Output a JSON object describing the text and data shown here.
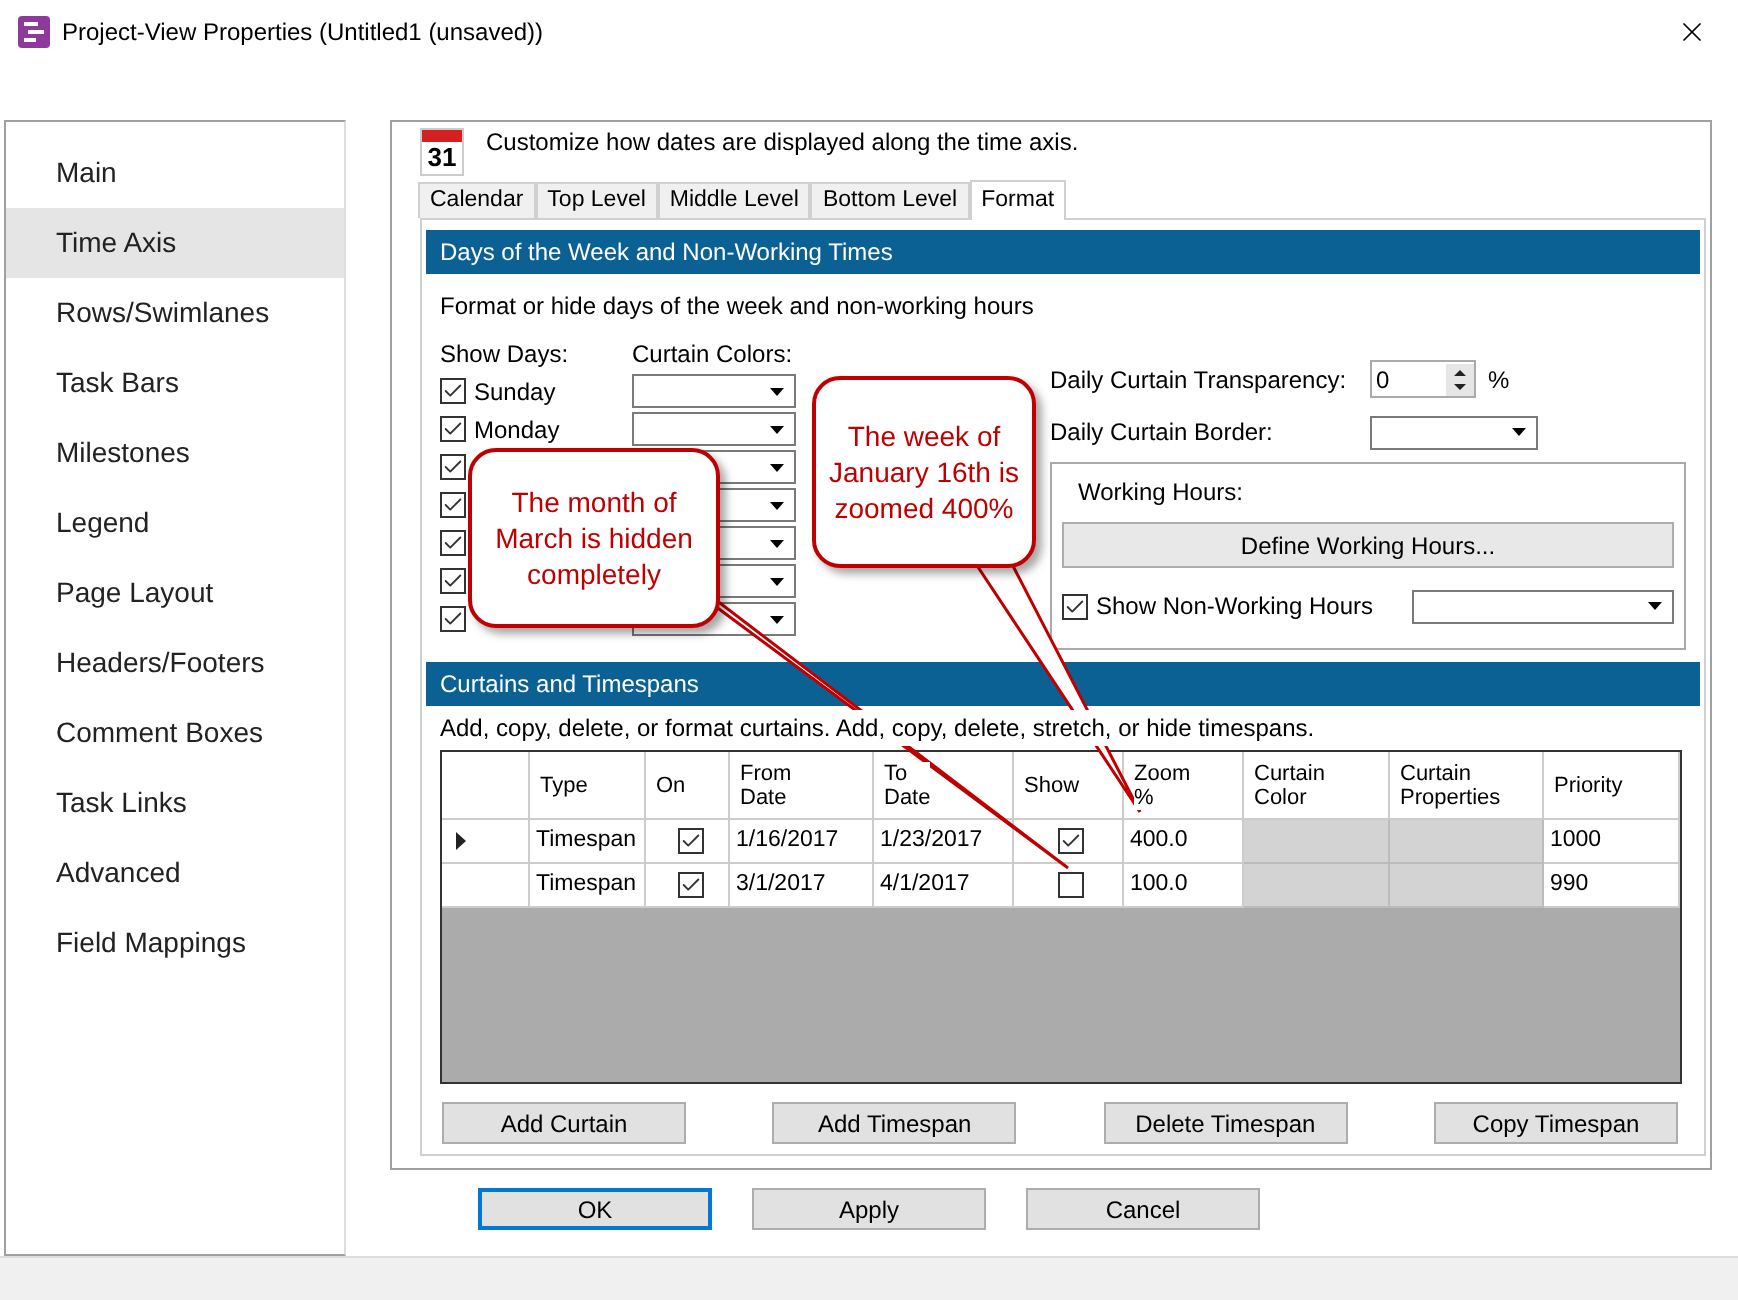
{
  "window": {
    "title": "Project-View Properties (Untitled1 (unsaved))"
  },
  "sidebar": {
    "items": [
      {
        "label": "Main",
        "selected": false
      },
      {
        "label": "Time Axis",
        "selected": true
      },
      {
        "label": "Rows/Swimlanes",
        "selected": false
      },
      {
        "label": "Task Bars",
        "selected": false
      },
      {
        "label": "Milestones",
        "selected": false
      },
      {
        "label": "Legend",
        "selected": false
      },
      {
        "label": "Page Layout",
        "selected": false
      },
      {
        "label": "Headers/Footers",
        "selected": false
      },
      {
        "label": "Comment Boxes",
        "selected": false
      },
      {
        "label": "Task Links",
        "selected": false
      },
      {
        "label": "Advanced",
        "selected": false
      },
      {
        "label": "Field Mappings",
        "selected": false
      }
    ]
  },
  "header": {
    "calendar_day": "31",
    "text": "Customize how dates are displayed along the time axis."
  },
  "tabs": [
    {
      "label": "Calendar",
      "selected": false
    },
    {
      "label": "Top Level",
      "selected": false
    },
    {
      "label": "Middle Level",
      "selected": false
    },
    {
      "label": "Bottom Level",
      "selected": false
    },
    {
      "label": "Format",
      "selected": true
    }
  ],
  "days_section": {
    "title": "Days of the Week and Non-Working Times",
    "subtitle": "Format or hide days of the week and non-working hours",
    "show_days_label": "Show Days:",
    "curtain_colors_label": "Curtain Colors:",
    "days": [
      {
        "label": "Sunday",
        "checked": true
      },
      {
        "label": "Monday",
        "checked": true
      },
      {
        "checked": true
      },
      {
        "checked": true
      },
      {
        "checked": true
      },
      {
        "checked": true
      },
      {
        "checked": true
      }
    ],
    "transparency_label": "Daily Curtain Transparency:",
    "transparency_value": "0",
    "transparency_unit": "%",
    "border_label": "Daily Curtain Border:",
    "working_hours": {
      "title": "Working Hours:",
      "define_button": "Define Working Hours...",
      "show_non_working": {
        "label": "Show Non-Working Hours",
        "checked": true
      }
    }
  },
  "curtains_section": {
    "title": "Curtains and Timespans",
    "subtitle": "Add, copy, delete, or format curtains.  Add, copy, delete, stretch, or hide timespans.",
    "columns": [
      "Type",
      "On",
      "From Date",
      "To Date",
      "Show",
      "Zoom %",
      "Curtain Color",
      "Curtain Properties",
      "Priority"
    ],
    "rows": [
      {
        "current": true,
        "type": "Timespan",
        "on": true,
        "from": "1/16/2017",
        "to": "1/23/2017",
        "show": true,
        "zoom": "400.0",
        "priority": "1000"
      },
      {
        "current": false,
        "type": "Timespan",
        "on": true,
        "from": "3/1/2017",
        "to": "4/1/2017",
        "show": false,
        "zoom": "100.0",
        "priority": "990"
      }
    ],
    "buttons": [
      "Add Curtain",
      "Add Timespan",
      "Delete Timespan",
      "Copy Timespan"
    ]
  },
  "callouts": [
    {
      "text": "The month of March is hidden completely"
    },
    {
      "text": "The week of January 16th is zoomed 400%"
    }
  ],
  "buttons": [
    {
      "label": "OK",
      "selected": true
    },
    {
      "label": "Apply",
      "selected": false
    },
    {
      "label": "Cancel",
      "selected": false
    }
  ]
}
